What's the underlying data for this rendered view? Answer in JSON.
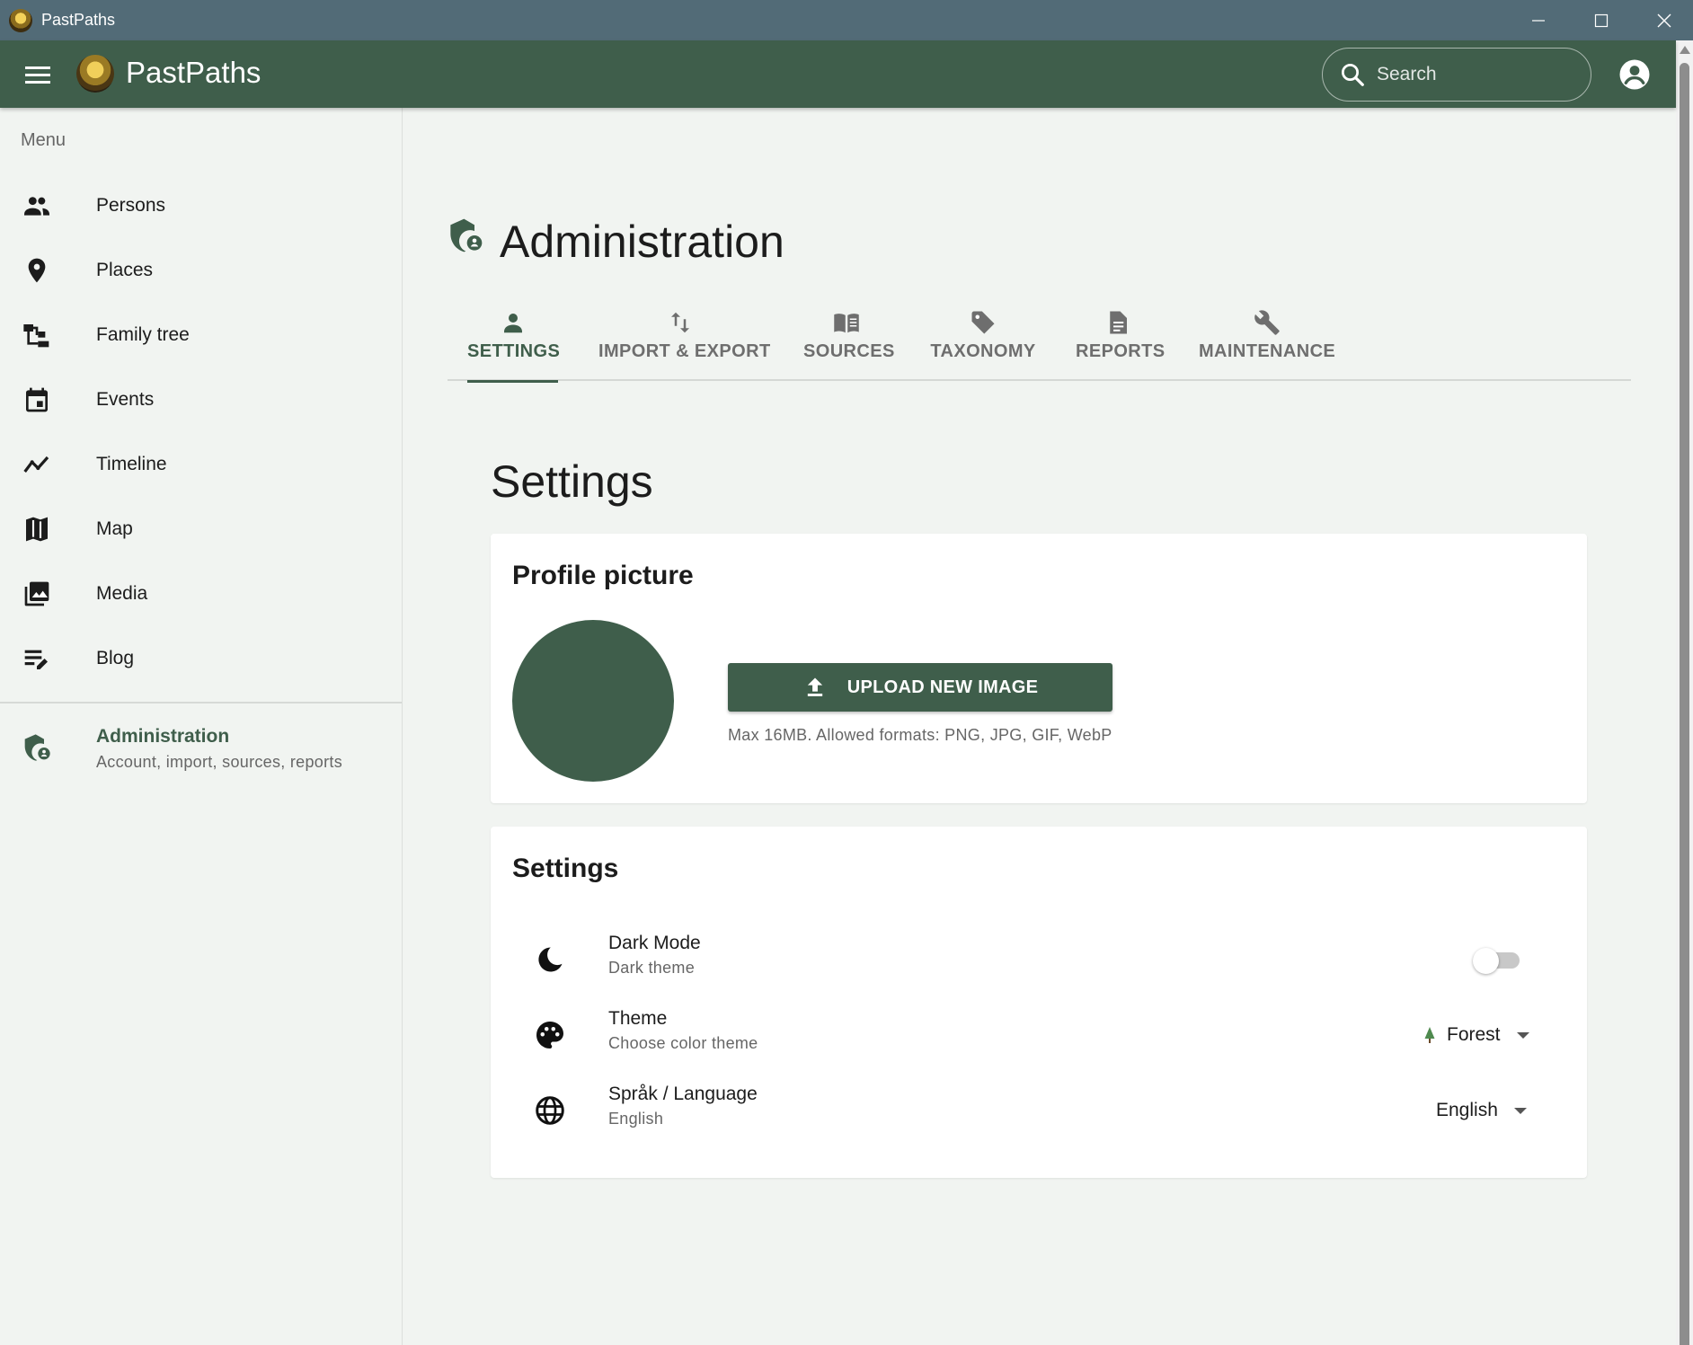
{
  "window": {
    "title": "PastPaths"
  },
  "appbar": {
    "brand": "PastPaths",
    "search_placeholder": "Search"
  },
  "sidebar": {
    "menu_label": "Menu",
    "items": [
      {
        "label": "Persons",
        "icon": "people-icon"
      },
      {
        "label": "Places",
        "icon": "map-pin-icon"
      },
      {
        "label": "Family tree",
        "icon": "family-tree-icon"
      },
      {
        "label": "Events",
        "icon": "calendar-event-icon"
      },
      {
        "label": "Timeline",
        "icon": "timeline-icon"
      },
      {
        "label": "Map",
        "icon": "map-icon"
      },
      {
        "label": "Media",
        "icon": "image-library-icon"
      },
      {
        "label": "Blog",
        "icon": "edit-note-icon"
      }
    ],
    "admin": {
      "label": "Administration",
      "sub": "Account, import, sources, reports"
    }
  },
  "main": {
    "title": "Administration",
    "tabs": [
      {
        "label": "SETTINGS",
        "icon": "person-icon",
        "active": true
      },
      {
        "label": "IMPORT & EXPORT",
        "icon": "import-export-icon",
        "active": false
      },
      {
        "label": "SOURCES",
        "icon": "book-icon",
        "active": false
      },
      {
        "label": "TAXONOMY",
        "icon": "tag-icon",
        "active": false
      },
      {
        "label": "REPORTS",
        "icon": "document-icon",
        "active": false
      },
      {
        "label": "MAINTENANCE",
        "icon": "wrench-icon",
        "active": false
      }
    ],
    "section_title": "Settings",
    "profile": {
      "title": "Profile picture",
      "upload_label": "UPLOAD NEW IMAGE",
      "hint": "Max 16MB. Allowed formats: PNG, JPG, GIF, WebP"
    },
    "settings": {
      "title": "Settings",
      "dark_mode": {
        "label": "Dark Mode",
        "sub": "Dark theme",
        "enabled": false
      },
      "theme": {
        "label": "Theme",
        "sub": "Choose color theme",
        "value": "Forest"
      },
      "language": {
        "label": "Språk / Language",
        "sub": "English",
        "value": "English"
      }
    }
  },
  "colors": {
    "primary": "#3f5e4b",
    "titlebar": "#526b77",
    "background": "#f1f4f1"
  }
}
